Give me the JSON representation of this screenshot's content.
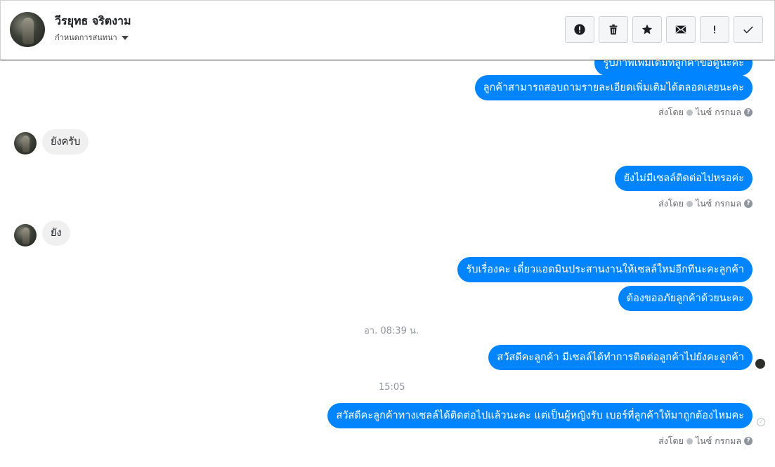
{
  "header": {
    "name": "วีรยุทธ จริตงาม",
    "assign_label": "กำหนดการสนทนา",
    "tools": [
      {
        "icon": "alert-circle-icon",
        "glyph": "!"
      },
      {
        "icon": "trash-icon"
      },
      {
        "icon": "star-icon"
      },
      {
        "icon": "envelope-icon"
      },
      {
        "icon": "exclamation-icon",
        "glyph": "!"
      },
      {
        "icon": "check-icon"
      }
    ]
  },
  "messages": {
    "m0": "ลูกค้าสามารถสอบถามรายละเอียดเพิ่มเติมได้ตลอดเลยนะคะ",
    "m0_partial": "รูปภาพเพิ่มเติมที่ลูกค้าขอดูนะคะ",
    "meta0": {
      "sent_by": "ส่งโดย",
      "agent": "ไนซ์ กรกมล",
      "q": "?"
    },
    "in1": "ยังครับ",
    "m1": "ยังไม่มีเซลล์ติดต่อไปหรอค่ะ",
    "meta1": {
      "sent_by": "ส่งโดย",
      "agent": "ไนซ์ กรกมล",
      "q": "?"
    },
    "in2": "ยัง",
    "m2": "รับเรื่องคะ เดี๋ยวแอดมินประสานงานให้เซลล์ใหม่อีกทีนะคะลูกค้า",
    "m3": "ต้องขออภัยลูกค้าด้วยนะคะ",
    "ts1": "อา. 08:39 น.",
    "m4": "สวัสดีคะลูกค้า มีเซลล์ได้ทำการติดต่อลูกค้าไปยังคะลูกค้า",
    "ts2": "15:05",
    "m5": "สวัสดีคะลูกค้าทางเซลล์ได้ติดต่อไปแล้วนะคะ แต่เป็นผู้หญิงรับ เบอร์ที่ลูกค้าให้มาถูกต้องไหมคะ",
    "meta2": {
      "sent_by": "ส่งโดย",
      "agent": "ไนซ์ กรกมล",
      "q": "?"
    }
  },
  "colors": {
    "outgoing": "#0084ff",
    "incoming": "#f1f0f0"
  }
}
